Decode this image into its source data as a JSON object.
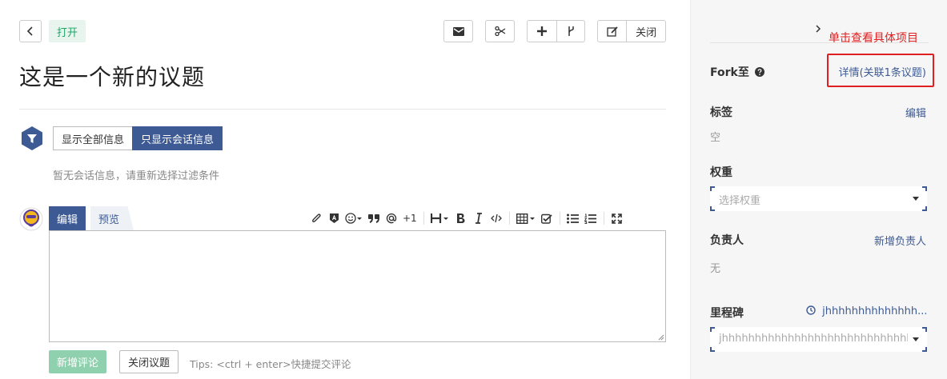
{
  "header": {
    "status": "打开",
    "close_label": "关闭"
  },
  "issue": {
    "title": "这是一个新的议题"
  },
  "filter": {
    "show_all": "显示全部信息",
    "show_comments": "只显示会话信息",
    "empty_note": "暂无会话信息，请重新选择过滤条件"
  },
  "editor": {
    "tab_edit": "编辑",
    "tab_preview": "预览",
    "plus_one": "+1",
    "submit": "新增评论",
    "close_issue": "关闭议题",
    "tips": "Tips: <ctrl + enter>快捷提交评论"
  },
  "sidebar": {
    "annotation": "单击查看具体项目",
    "fork_label": "Fork至",
    "fork_link": "详情(关联1条议题)",
    "tags_label": "标签",
    "tags_edit": "编辑",
    "tags_value": "空",
    "weight_label": "权重",
    "weight_placeholder": "选择权重",
    "assignee_label": "负责人",
    "assignee_add": "新增负责人",
    "assignee_value": "无",
    "milestone_label": "里程碑",
    "milestone_value": "jhhhhhhhhhhhhhh...",
    "milestone_placeholder": "jhhhhhhhhhhhhhhhhhhhhhhhhhhhhhhh..."
  },
  "colors": {
    "primary": "#3d5a94",
    "success": "#21a366",
    "annotation": "#e02020"
  }
}
